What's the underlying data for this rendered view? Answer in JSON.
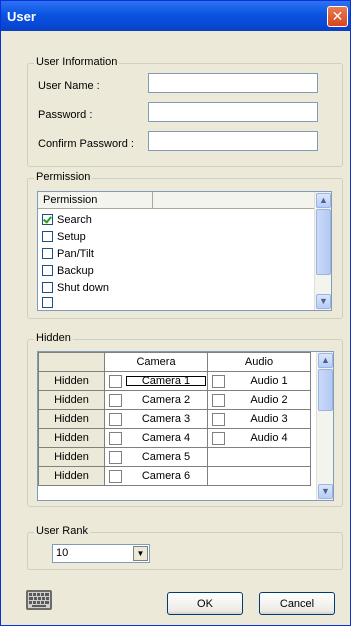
{
  "window": {
    "title": "User",
    "close_label": "✕"
  },
  "user_info": {
    "group_label": "User Information",
    "user_name_label": "User Name :",
    "user_name_value": "",
    "password_label": "Password :",
    "password_value": "",
    "confirm_label": "Confirm Password :",
    "confirm_value": ""
  },
  "permission": {
    "group_label": "Permission",
    "column_header": "Permission",
    "items": [
      {
        "label": "Search",
        "checked": true
      },
      {
        "label": "Setup",
        "checked": false
      },
      {
        "label": "Pan/Tilt",
        "checked": false
      },
      {
        "label": "Backup",
        "checked": false
      },
      {
        "label": "Shut down",
        "checked": false
      }
    ]
  },
  "hidden": {
    "group_label": "Hidden",
    "col_camera": "Camera",
    "col_audio": "Audio",
    "rows": [
      {
        "label": "Hidden",
        "camera": "Camera 1",
        "audio": "Audio 1"
      },
      {
        "label": "Hidden",
        "camera": "Camera 2",
        "audio": "Audio 2"
      },
      {
        "label": "Hidden",
        "camera": "Camera 3",
        "audio": "Audio 3"
      },
      {
        "label": "Hidden",
        "camera": "Camera 4",
        "audio": "Audio 4"
      },
      {
        "label": "Hidden",
        "camera": "Camera 5",
        "audio": ""
      },
      {
        "label": "Hidden",
        "camera": "Camera 6",
        "audio": ""
      }
    ]
  },
  "user_rank": {
    "group_label": "User Rank",
    "value": "10"
  },
  "buttons": {
    "ok": "OK",
    "cancel": "Cancel"
  },
  "icons": {
    "close": "close-icon",
    "keyboard": "keyboard-icon"
  }
}
